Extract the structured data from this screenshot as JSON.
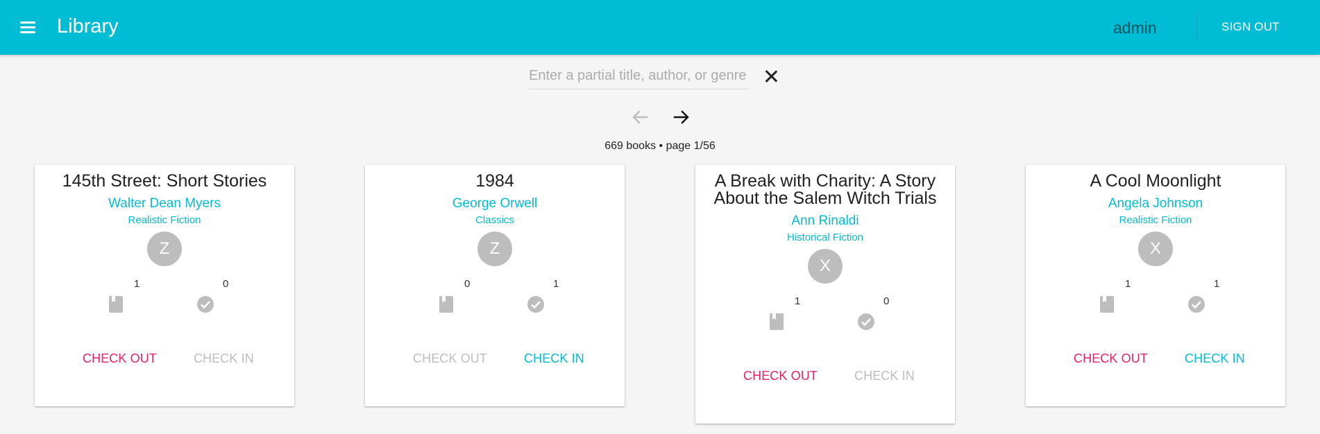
{
  "header": {
    "title": "Library",
    "user": "admin",
    "sign_out_label": "SIGN OUT",
    "background": "#00bcd4"
  },
  "search": {
    "placeholder": "Enter a partial title, author, or genre",
    "value": ""
  },
  "pagination": {
    "info": "669 books • page 1/56",
    "prev_enabled": false,
    "next_enabled": true
  },
  "colors": {
    "accent": "#00bcd4",
    "checkout_active": "#e91e63",
    "disabled": "#bdbdbd"
  },
  "books": [
    {
      "title": "145th Street: Short Stories",
      "author": "Walter Dean Myers",
      "genre": "Realistic Fiction",
      "initial": "Z",
      "copies": "1",
      "checked_out": "0",
      "check_out_label": "CHECK OUT",
      "check_in_label": "CHECK IN",
      "check_out_enabled": true,
      "check_in_enabled": false
    },
    {
      "title": "1984",
      "author": "George Orwell",
      "genre": "Classics",
      "initial": "Z",
      "copies": "0",
      "checked_out": "1",
      "check_out_label": "CHECK OUT",
      "check_in_label": "CHECK IN",
      "check_out_enabled": false,
      "check_in_enabled": true
    },
    {
      "title": "A Break with Charity: A Story About the Salem Witch Trials",
      "author": "Ann Rinaldi",
      "genre": "Historical Fiction",
      "initial": "X",
      "copies": "1",
      "checked_out": "0",
      "check_out_label": "CHECK OUT",
      "check_in_label": "CHECK IN",
      "check_out_enabled": true,
      "check_in_enabled": false
    },
    {
      "title": "A Cool Moonlight",
      "author": "Angela Johnson",
      "genre": "Realistic Fiction",
      "initial": "X",
      "copies": "1",
      "checked_out": "1",
      "check_out_label": "CHECK OUT",
      "check_in_label": "CHECK IN",
      "check_out_enabled": true,
      "check_in_enabled": true
    }
  ]
}
